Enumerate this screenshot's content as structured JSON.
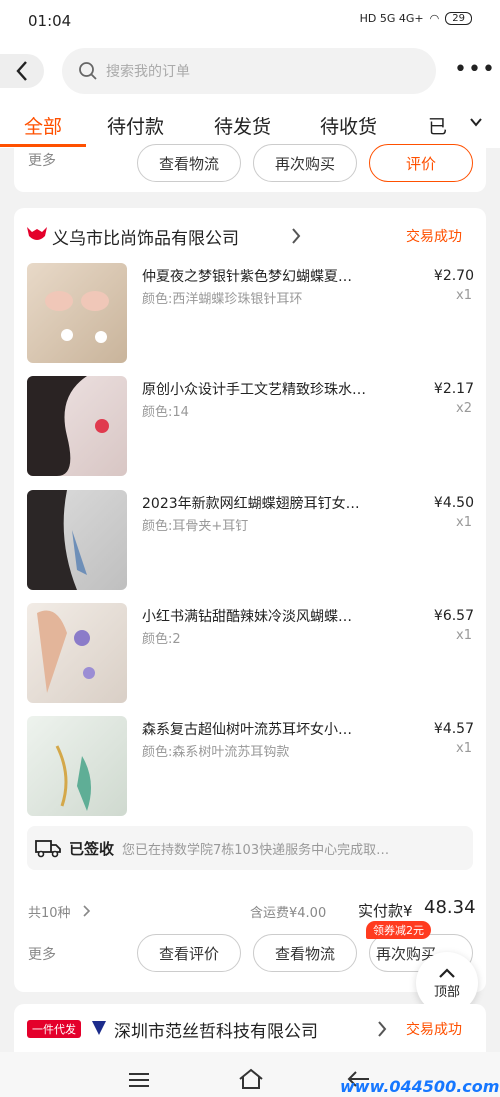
{
  "status_bar": {
    "time": "01:04",
    "network": "HD 5G 4G+",
    "battery": "29"
  },
  "header": {
    "search_placeholder": "搜索我的订单"
  },
  "tabs": [
    "全部",
    "待付款",
    "待发货",
    "待收货",
    "已"
  ],
  "prev_order": {
    "more": "更多",
    "buttons": [
      "查看物流",
      "再次购买",
      "评价"
    ]
  },
  "order": {
    "shop_name": "义乌市比尚饰品有限公司",
    "status": "交易成功",
    "items": [
      {
        "title": "仲夏夜之梦银针紫色梦幻蝴蝶夏…",
        "spec": "颜色:西洋蝴蝶珍珠银针耳环",
        "price": "¥2.70",
        "qty": "x1"
      },
      {
        "title": "原创小众设计手工文艺精致珍珠水…",
        "spec": "颜色:14",
        "price": "¥2.17",
        "qty": "x2"
      },
      {
        "title": "2023年新款网红蝴蝶翅膀耳钉女…",
        "spec": "颜色:耳骨夹+耳钉",
        "price": "¥4.50",
        "qty": "x1"
      },
      {
        "title": "小红书满钻甜酷辣妹冷淡风蝴蝶…",
        "spec": "颜色:2",
        "price": "¥6.57",
        "qty": "x1"
      },
      {
        "title": "森系复古超仙树叶流苏耳坏女小…",
        "spec": "颜色:森系树叶流苏耳钩款",
        "price": "¥4.57",
        "qty": "x1"
      }
    ],
    "logistics_status": "已签收",
    "logistics_detail": "您已在持数学院7栋103快递服务中心完成取…",
    "count": "共10种",
    "shipping": "含运费¥4.00",
    "paid_label": "实付款¥",
    "paid_amount": "48.34",
    "coupon_badge": "领券减2元",
    "more": "更多",
    "buttons": [
      "查看评价",
      "查看物流",
      "再次购买"
    ]
  },
  "top_button": "顶部",
  "next_order": {
    "badge": "一件代发",
    "shop_name": "深圳市范丝哲科技有限公司",
    "status": "交易成功"
  },
  "watermark": "www.044500.com"
}
